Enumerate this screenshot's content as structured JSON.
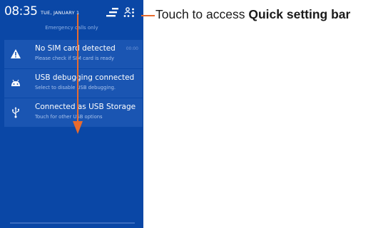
{
  "status_bar": {
    "time": "08:35",
    "date": "TUE, JANUARY 1"
  },
  "emergency_text": "Emergency calls only",
  "notifications": [
    {
      "icon": "warning-icon",
      "title": "No SIM card detected",
      "subtitle": "Please check if SIM card is ready",
      "time": "00:00"
    },
    {
      "icon": "android-icon",
      "title": "USB debugging connected",
      "subtitle": "Select to disable USB debugging."
    },
    {
      "icon": "usb-icon",
      "title": "Connected as USB Storage",
      "subtitle": "Touch for other USB options"
    }
  ],
  "callout": {
    "prefix": "Touch to access ",
    "bold": "Quick setting bar"
  },
  "colors": {
    "panel": "#0a47a6",
    "card": "#1a55b2",
    "arrow": "#e86b2e"
  }
}
